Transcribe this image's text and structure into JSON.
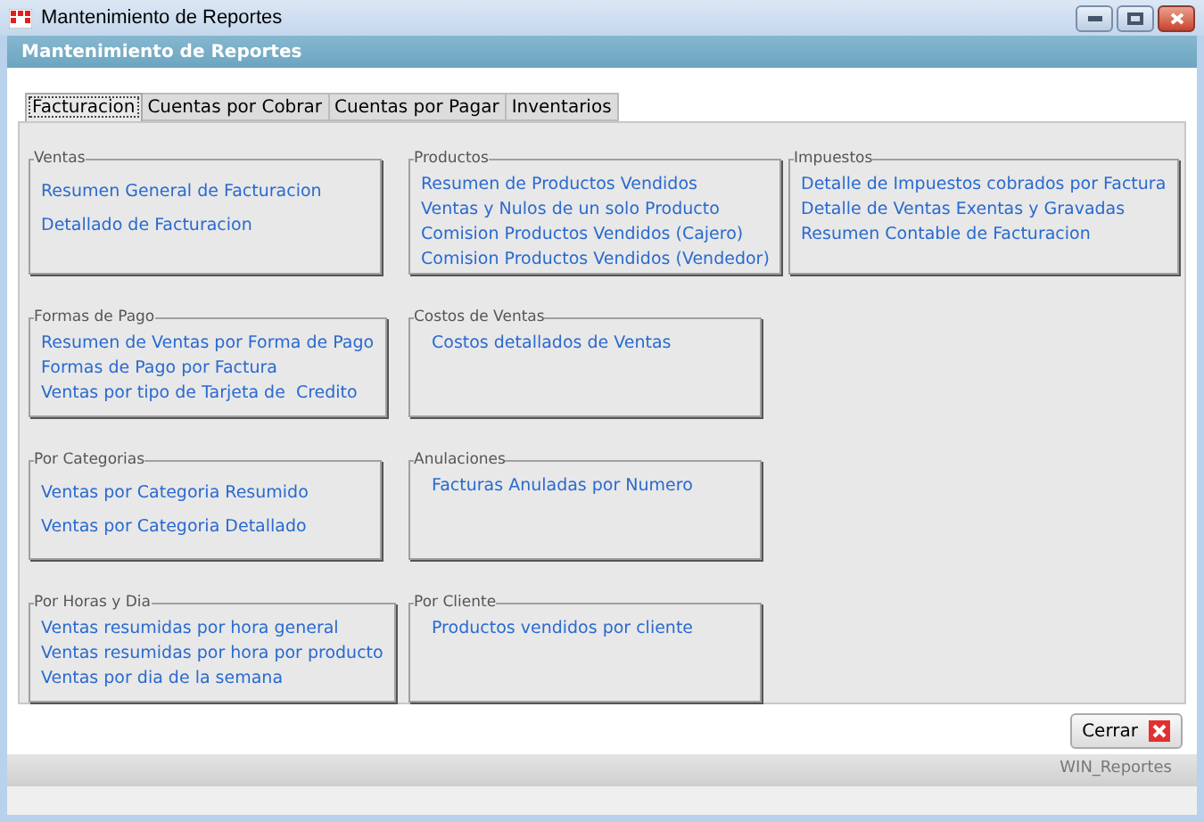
{
  "window": {
    "title": "Mantenimiento de Reportes"
  },
  "header": {
    "title": "Mantenimiento de Reportes"
  },
  "tabs": [
    {
      "label": "Facturacion",
      "selected": true
    },
    {
      "label": "Cuentas por Cobrar",
      "selected": false
    },
    {
      "label": "Cuentas por Pagar",
      "selected": false
    },
    {
      "label": "Inventarios",
      "selected": false
    }
  ],
  "columns": [
    [
      {
        "title": "Ventas",
        "spacious": true,
        "reports": [
          "Resumen General de Facturacion",
          "Detallado de Facturacion"
        ]
      },
      {
        "title": "Formas de Pago",
        "reports": [
          "Resumen de Ventas por Forma de Pago",
          "Formas de Pago por Factura",
          "Ventas por tipo de Tarjeta de  Credito"
        ]
      },
      {
        "title": "Por Categorias",
        "spacious": true,
        "reports": [
          "Ventas por Categoria Resumido",
          "Ventas por Categoria Detallado"
        ]
      },
      {
        "title": "Por Horas y Dia",
        "reports": [
          "Ventas resumidas por hora general",
          "Ventas resumidas por hora por producto",
          "Ventas por dia de la semana"
        ]
      }
    ],
    [
      {
        "title": "Productos",
        "reports": [
          "Resumen de Productos Vendidos",
          "Ventas y Nulos de un solo Producto",
          "Comision Productos Vendidos (Cajero)",
          "Comision Productos Vendidos (Vendedor)"
        ]
      },
      {
        "title": "Costos de Ventas",
        "indented": true,
        "reports": [
          "Costos detallados de Ventas"
        ]
      },
      {
        "title": "Anulaciones",
        "indented": true,
        "reports": [
          "Facturas Anuladas por Numero"
        ]
      },
      {
        "title": "Por Cliente",
        "indented": true,
        "reports": [
          "Productos vendidos por cliente"
        ]
      }
    ],
    [
      {
        "title": "Impuestos",
        "reports": [
          "Detalle de Impuestos cobrados por Factura",
          "Detalle de Ventas Exentas y Gravadas",
          "Resumen Contable de Facturacion"
        ]
      }
    ]
  ],
  "close_button": {
    "label": "Cerrar"
  },
  "status_bar": {
    "text": "WIN_Reportes"
  }
}
